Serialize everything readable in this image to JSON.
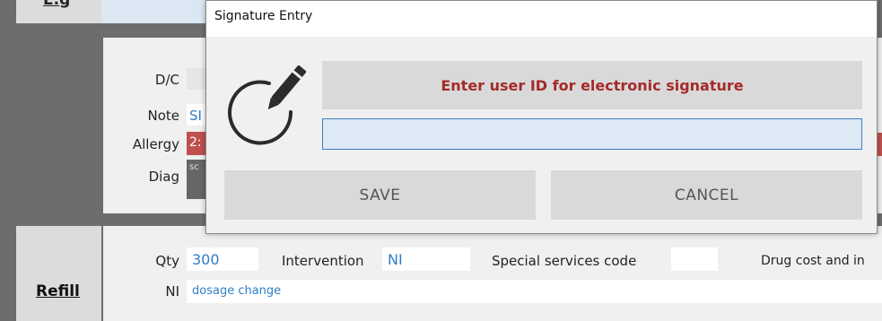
{
  "background": {
    "top_left_label": "E.g",
    "labels": {
      "dc": "D/C",
      "note": "Note",
      "allergy": "Allergy",
      "diag": "Diag"
    },
    "fields": {
      "note_value": "SI",
      "allergy_value": "2:",
      "diag_value": "sc"
    },
    "refill": {
      "row_label": "Refill",
      "qty_label": "Qty",
      "qty_value": "300",
      "intervention_label": "Intervention",
      "intervention_value": "NI",
      "special_services_label": "Special services code",
      "special_services_value": "",
      "drug_cost_label": "Drug cost and in",
      "ni_label": "NI",
      "ni_value": "dosage change"
    }
  },
  "dialog": {
    "title": "Signature Entry",
    "icon": "pen-signature-icon",
    "prompt": "Enter user ID for electronic signature",
    "input_value": "",
    "save_label": "SAVE",
    "cancel_label": "CANCEL"
  },
  "colors": {
    "prompt_text": "#a52a2a",
    "input_border": "#3c7fc1",
    "input_fill": "#dde9f5",
    "allergy_fill": "#c0504d",
    "link_blue": "#2f7ec7"
  }
}
